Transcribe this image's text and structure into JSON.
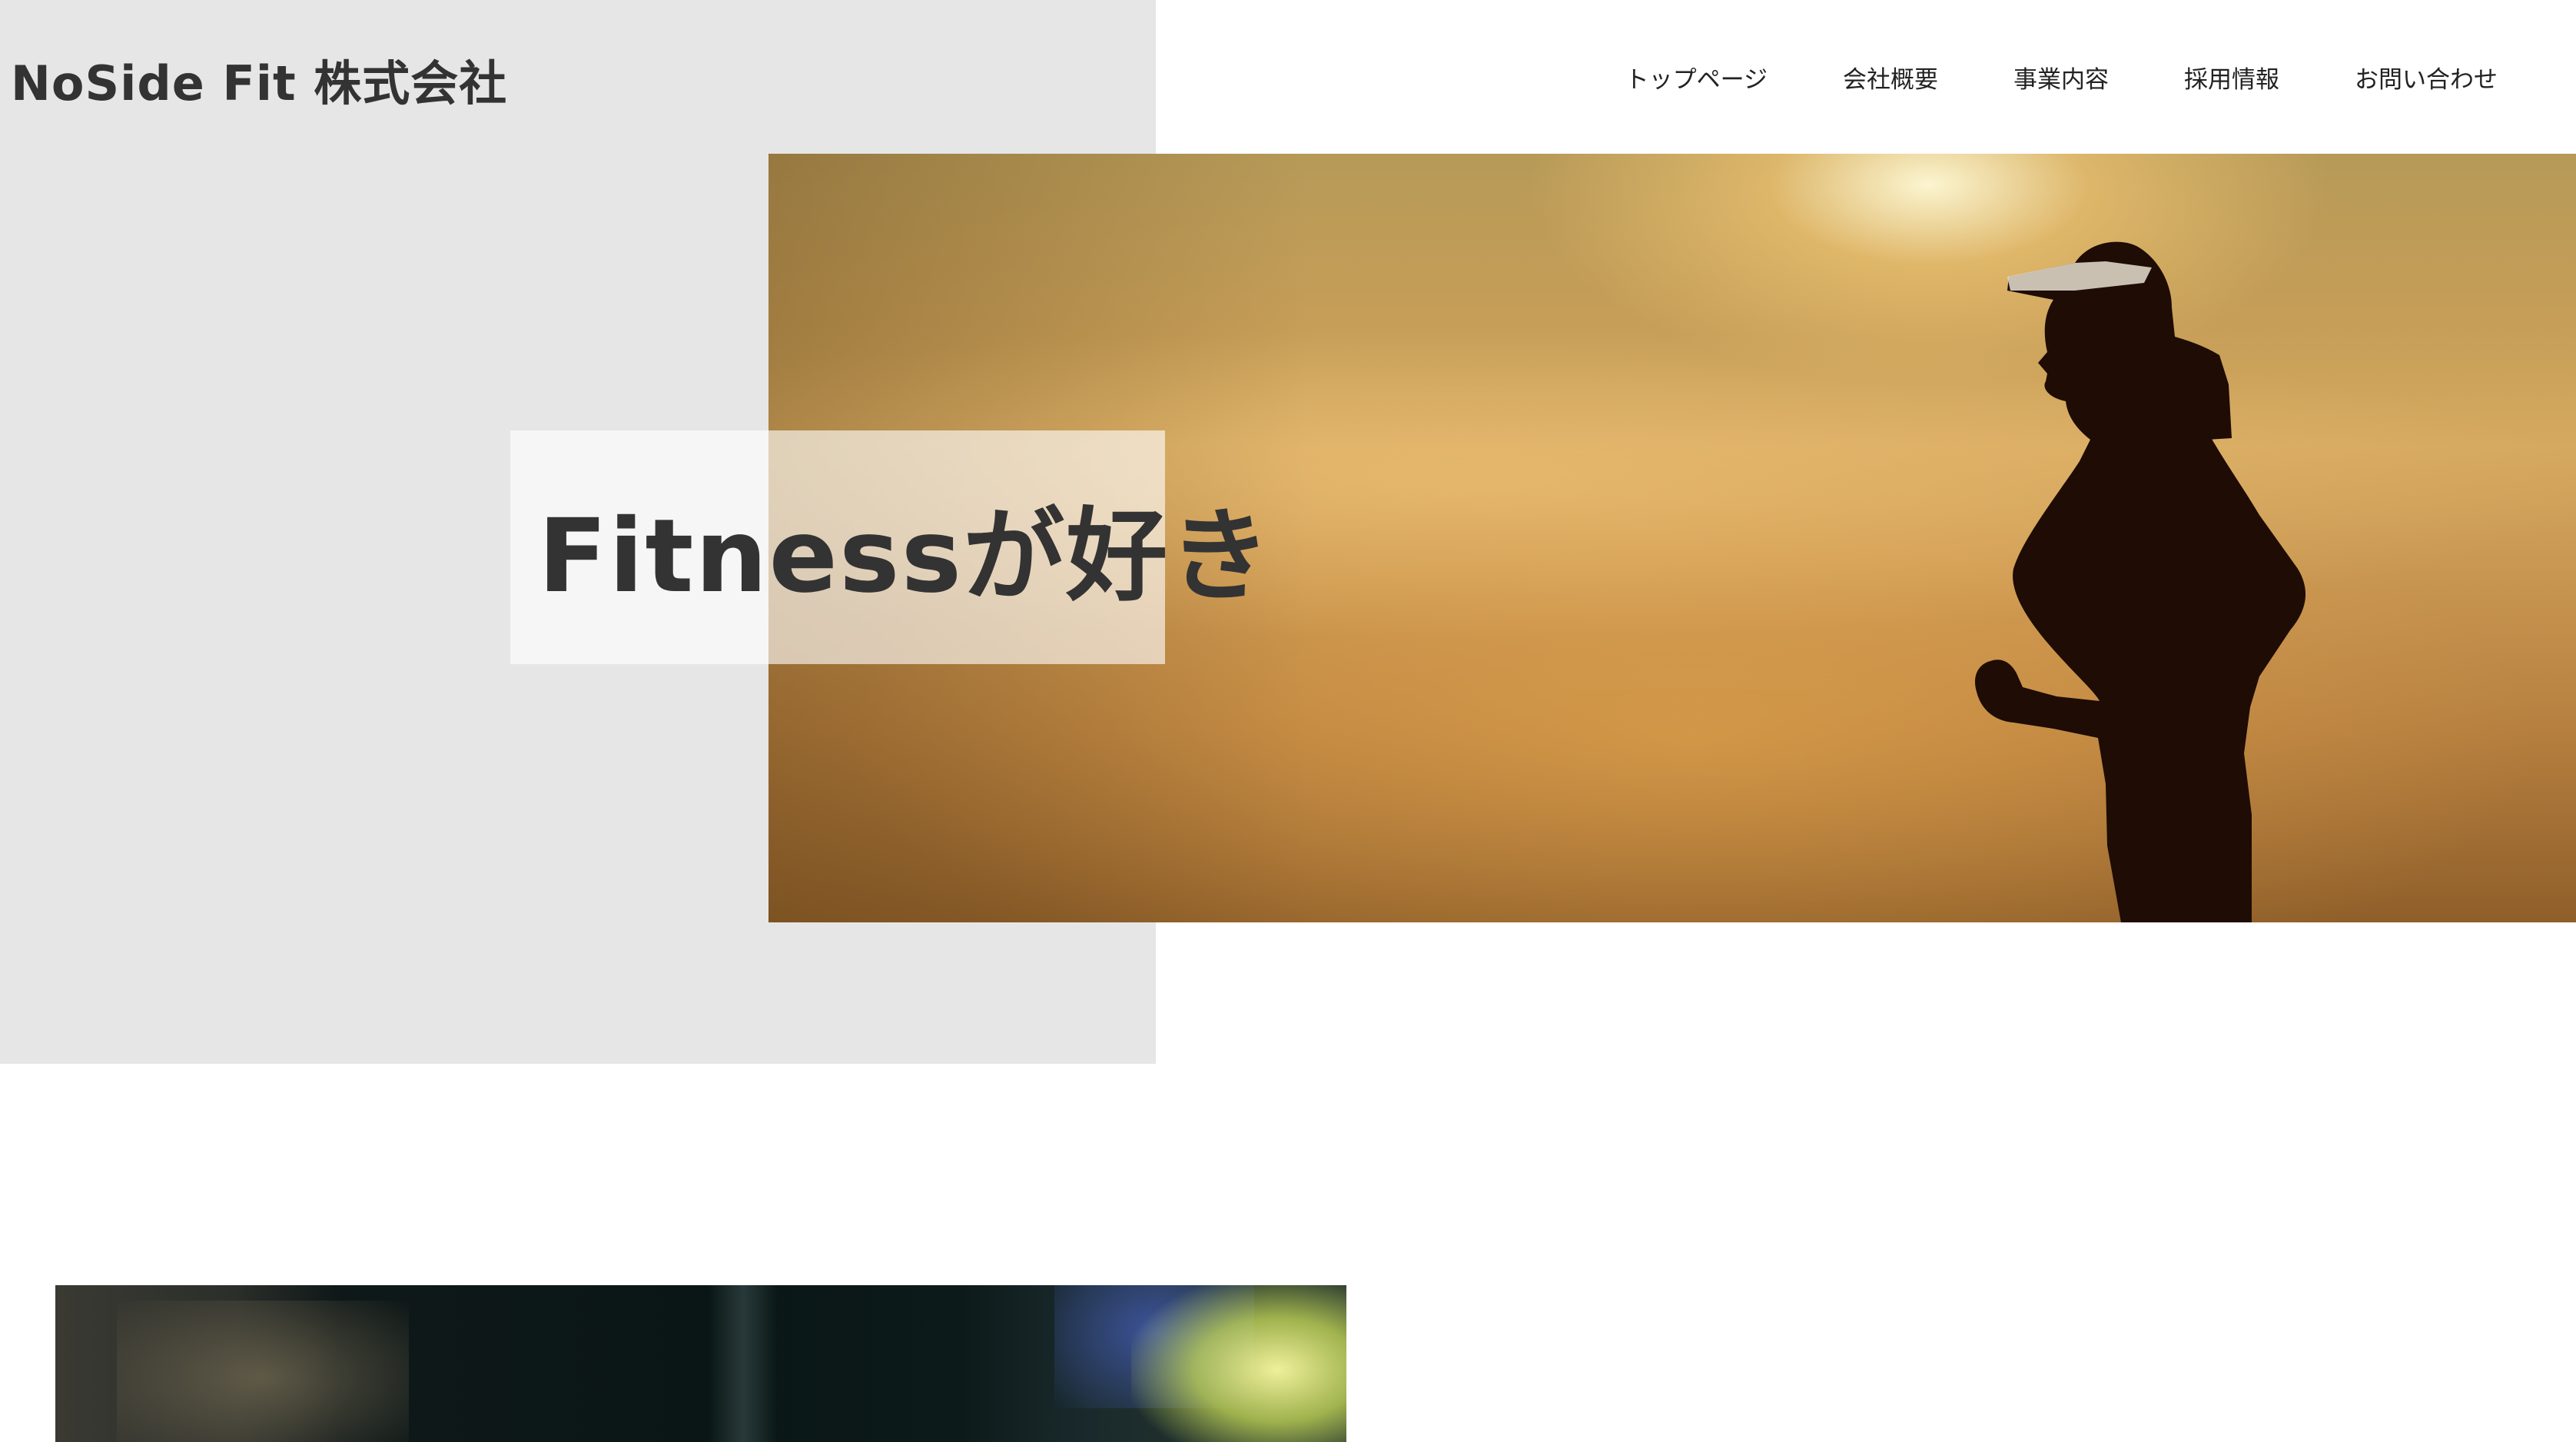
{
  "header": {
    "logo": "NoSide Fit 株式会社"
  },
  "nav": {
    "items": [
      {
        "label": "トップページ"
      },
      {
        "label": "会社概要"
      },
      {
        "label": "事業内容"
      },
      {
        "label": "採用情報"
      },
      {
        "label": "お問い合わせ"
      }
    ]
  },
  "hero": {
    "title": "Fitnessが好き"
  },
  "colors": {
    "panel_grey": "#e6e6e6",
    "text": "#333333",
    "background": "#ffffff"
  }
}
